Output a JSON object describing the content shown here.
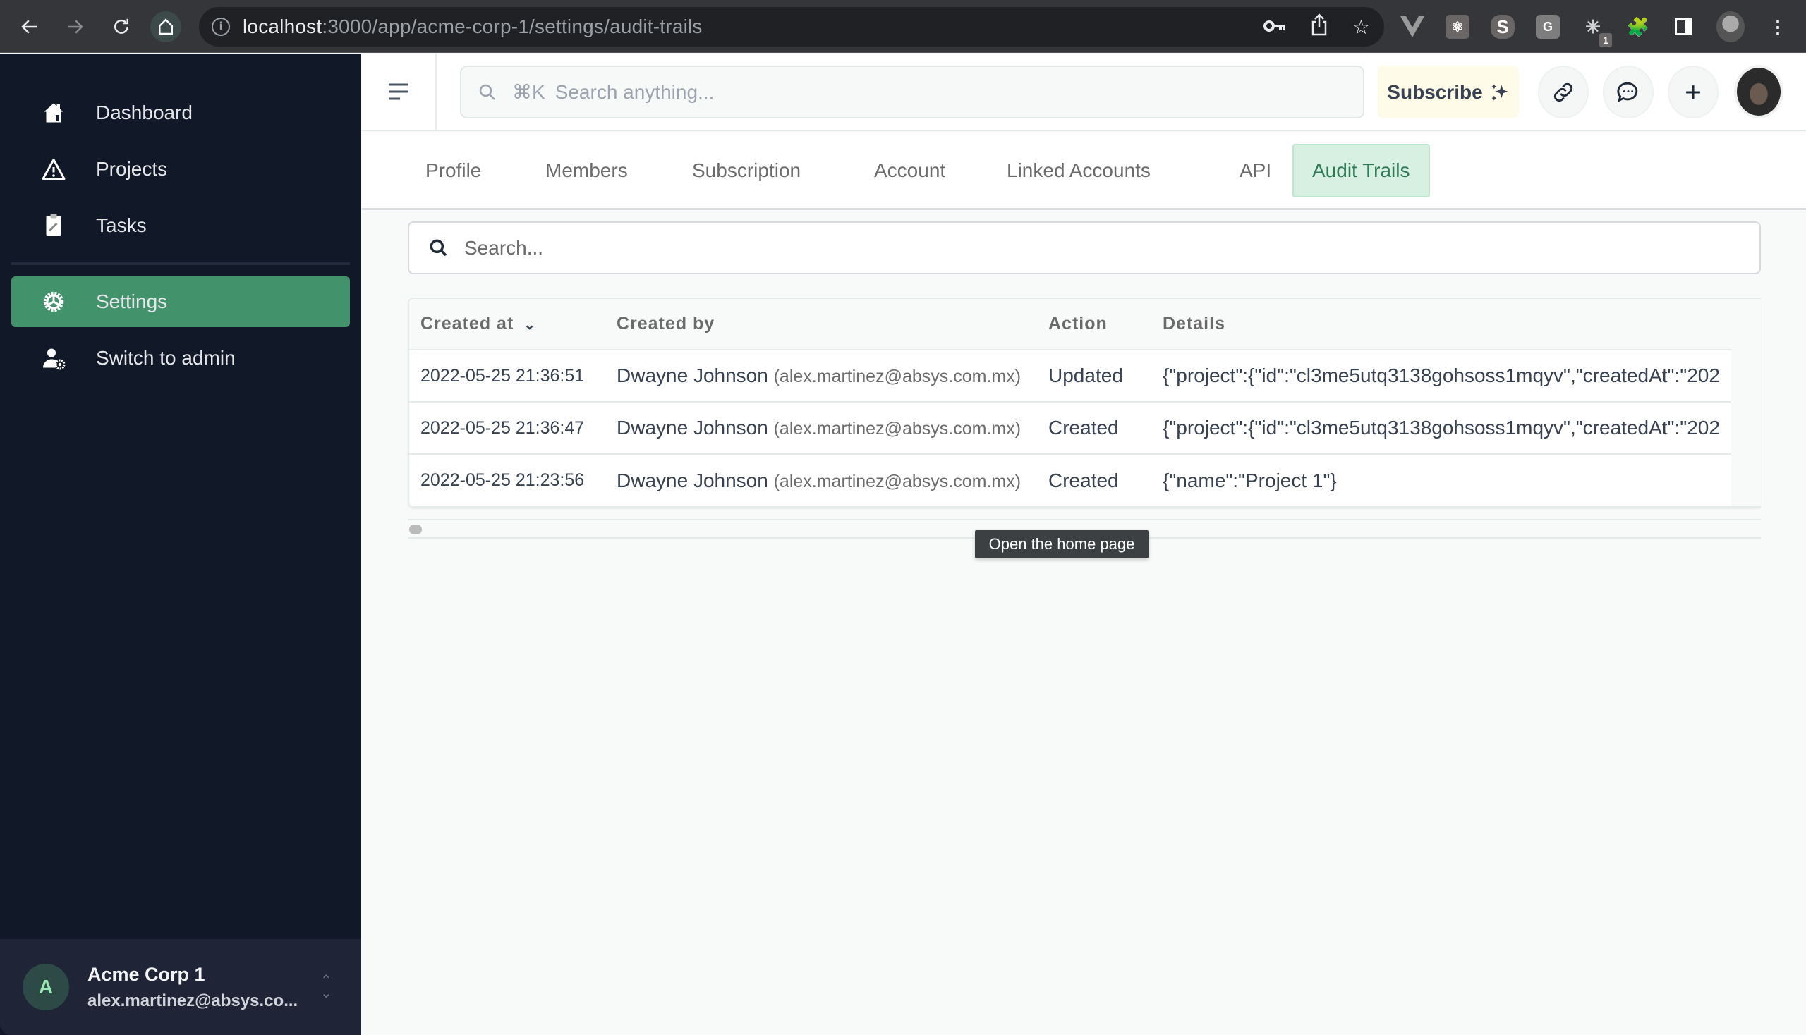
{
  "browser": {
    "url_host": "localhost",
    "url_path": ":3000/app/acme-corp-1/settings/audit-trails",
    "extension_badge": "1"
  },
  "sidebar": {
    "items": [
      {
        "label": "Dashboard",
        "icon": "home-icon"
      },
      {
        "label": "Projects",
        "icon": "warning-triangle-icon"
      },
      {
        "label": "Tasks",
        "icon": "clipboard-icon"
      },
      {
        "label": "Settings",
        "icon": "gear-icon",
        "active": true
      },
      {
        "label": "Switch to admin",
        "icon": "user-gear-icon"
      }
    ],
    "account": {
      "avatar_letter": "A",
      "name": "Acme Corp 1",
      "email": "alex.martinez@absys.co..."
    }
  },
  "header": {
    "search_shortcut": "⌘K",
    "search_placeholder": "Search anything...",
    "subscribe_label": "Subscribe"
  },
  "tabs": [
    {
      "label": "Profile"
    },
    {
      "label": "Members"
    },
    {
      "label": "Subscription"
    },
    {
      "label": "Account"
    },
    {
      "label": "Linked Accounts"
    },
    {
      "label": "API"
    },
    {
      "label": "Audit Trails",
      "active": true
    }
  ],
  "content": {
    "search_placeholder": "Search...",
    "table": {
      "columns": [
        "Created at",
        "Created by",
        "Action",
        "Details"
      ],
      "rows": [
        {
          "created_at": "2022-05-25 21:36:51",
          "user": "Dwayne Johnson",
          "email": "(alex.martinez@absys.com.mx)",
          "action": "Updated",
          "details": "{\"project\":{\"id\":\"cl3me5utq3138gohsoss1mqyv\",\"createdAt\":\"202"
        },
        {
          "created_at": "2022-05-25 21:36:47",
          "user": "Dwayne Johnson",
          "email": "(alex.martinez@absys.com.mx)",
          "action": "Created",
          "details": "{\"project\":{\"id\":\"cl3me5utq3138gohsoss1mqyv\",\"createdAt\":\"202"
        },
        {
          "created_at": "2022-05-25 21:23:56",
          "user": "Dwayne Johnson",
          "email": "(alex.martinez@absys.com.mx)",
          "action": "Created",
          "details": "{\"name\":\"Project 1\"}"
        }
      ]
    },
    "tooltip": "Open the home page"
  },
  "colors": {
    "sidebar_bg": "#111827",
    "accent": "#42936c",
    "active_tab_bg": "#d7f0e2",
    "subscribe_bg": "#fefbe8"
  }
}
